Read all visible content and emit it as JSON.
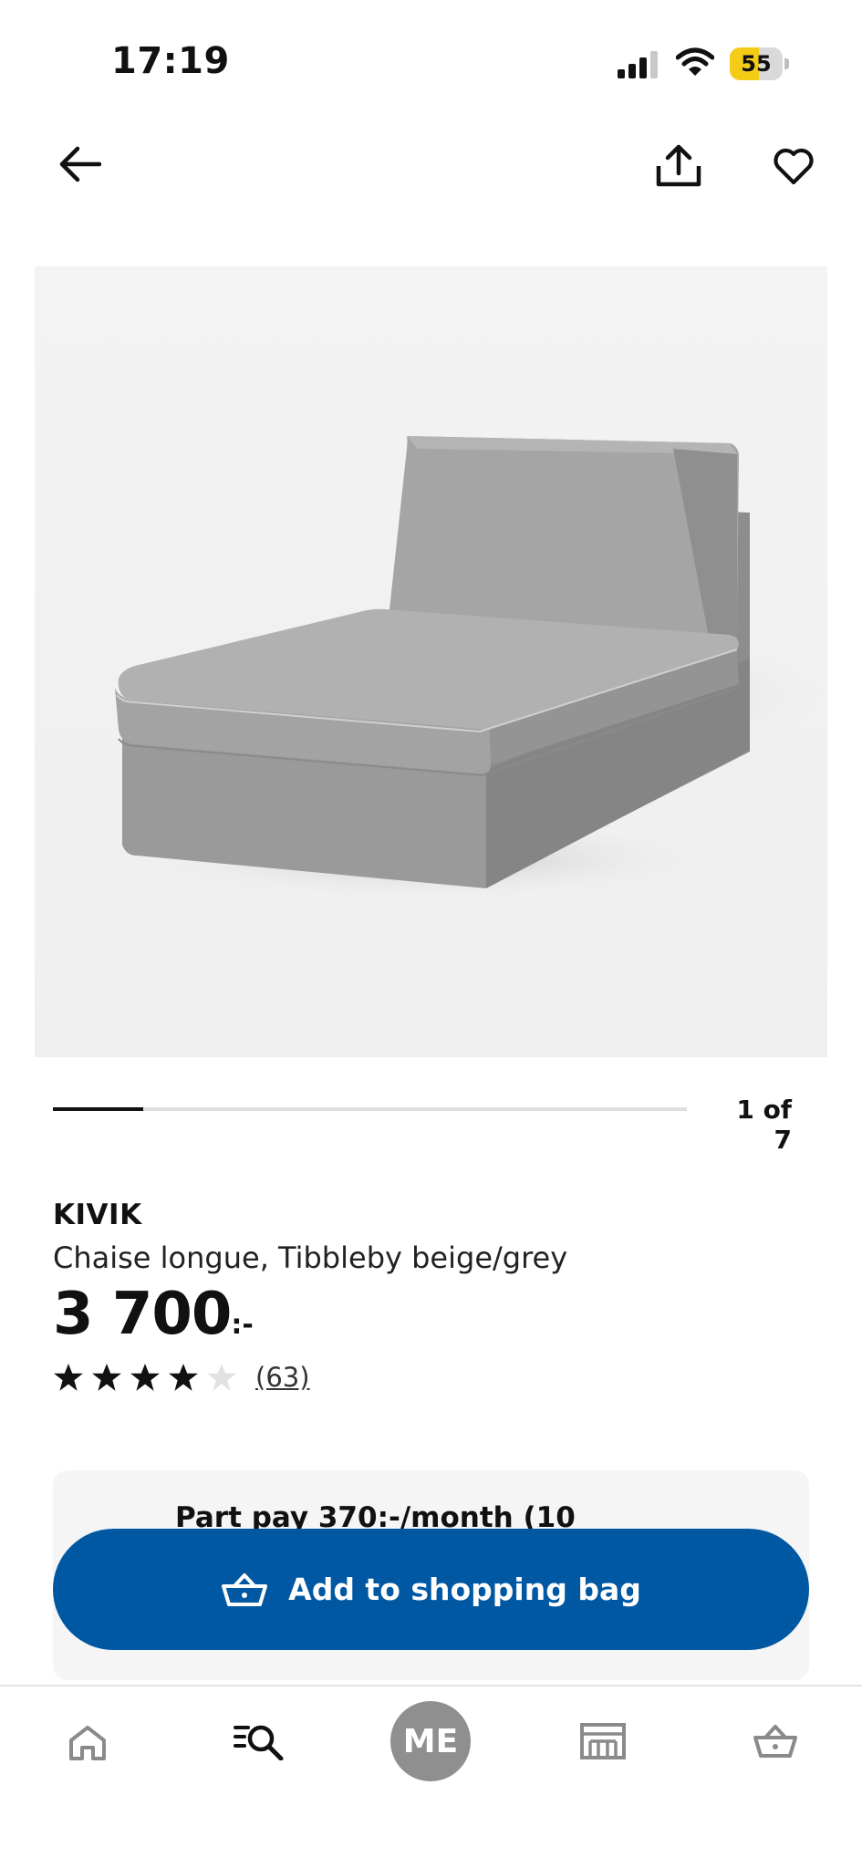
{
  "status_bar": {
    "time": "17:19",
    "battery_level": "55",
    "battery_percent": 55,
    "icons": [
      "signal-icon",
      "wifi-icon",
      "battery-icon"
    ]
  },
  "top_nav": {
    "icons": [
      "back-arrow-icon",
      "share-icon",
      "heart-icon"
    ]
  },
  "product_image": {
    "icon": "chaise-longue-image"
  },
  "carousel": {
    "counter": "1 of 7",
    "progress_fraction": 0.143
  },
  "product": {
    "name": "KIVIK",
    "description": "Chaise longue, Tibbleby beige/grey",
    "price": "3 700",
    "price_suffix": ":-",
    "rating": 4,
    "rating_max": 5,
    "review_count": "(63)"
  },
  "part_pay": {
    "text": "Part pay 370:-/month (10"
  },
  "add_to_bag": {
    "label": "Add to shopping bag",
    "icon": "basket-icon",
    "color": "#0058a3"
  },
  "bottom_nav": {
    "me_label": "ME",
    "icons": [
      "home-icon",
      "search-icon",
      "me-avatar",
      "store-icon",
      "basket-icon"
    ]
  }
}
